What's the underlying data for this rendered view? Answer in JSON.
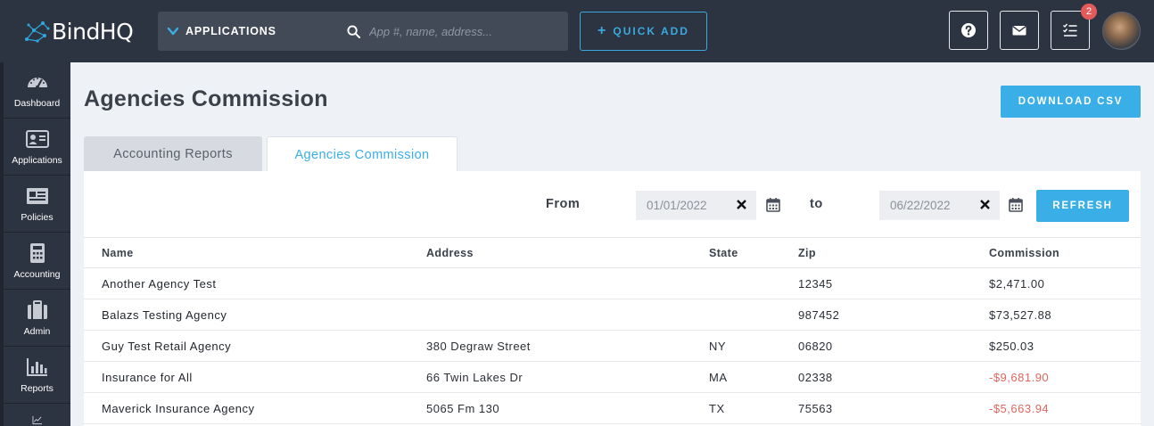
{
  "brand": {
    "name": "BindHQ"
  },
  "topbar": {
    "app_select_label": "APPLICATIONS",
    "search_placeholder": "App #, name, address...",
    "quick_add_plus": "+",
    "quick_add_label": "QUICK ADD",
    "notification_count": "2"
  },
  "sidebar": {
    "items": [
      {
        "label": "Dashboard",
        "icon": "dashboard-icon"
      },
      {
        "label": "Applications",
        "icon": "id-card-icon"
      },
      {
        "label": "Policies",
        "icon": "policy-icon"
      },
      {
        "label": "Accounting",
        "icon": "calculator-icon"
      },
      {
        "label": "Admin",
        "icon": "briefcase-icon"
      },
      {
        "label": "Reports",
        "icon": "bar-chart-icon"
      }
    ]
  },
  "page": {
    "title": "Agencies Commission",
    "download_label": "DOWNLOAD CSV",
    "tabs": [
      {
        "label": "Accounting Reports",
        "active": false
      },
      {
        "label": "Agencies Commission",
        "active": true
      }
    ]
  },
  "filter": {
    "from_label": "From",
    "from_value": "01/01/2022",
    "to_label": "to",
    "to_value": "06/22/2022",
    "refresh_label": "REFRESH"
  },
  "table": {
    "headers": [
      "Name",
      "Address",
      "State",
      "Zip",
      "Commission"
    ],
    "rows": [
      {
        "name": "Another Agency Test",
        "address": "",
        "state": "",
        "zip": "12345",
        "commission": "$2,471.00"
      },
      {
        "name": "Balazs Testing Agency",
        "address": "",
        "state": "",
        "zip": "987452",
        "commission": "$73,527.88"
      },
      {
        "name": "Guy Test Retail Agency",
        "address": "380 Degraw Street",
        "state": "NY",
        "zip": "06820",
        "commission": "$250.03"
      },
      {
        "name": "Insurance for All",
        "address": "66 Twin Lakes Dr",
        "state": "MA",
        "zip": "02338",
        "commission": "-$9,681.90"
      },
      {
        "name": "Maverick Insurance Agency",
        "address": "5065 Fm 130",
        "state": "TX",
        "zip": "75563",
        "commission": "-$5,663.94"
      }
    ]
  },
  "colors": {
    "accent": "#3aaee7",
    "topbar": "#2d3441",
    "negative": "#e0675e",
    "badge": "#e55a5a"
  }
}
